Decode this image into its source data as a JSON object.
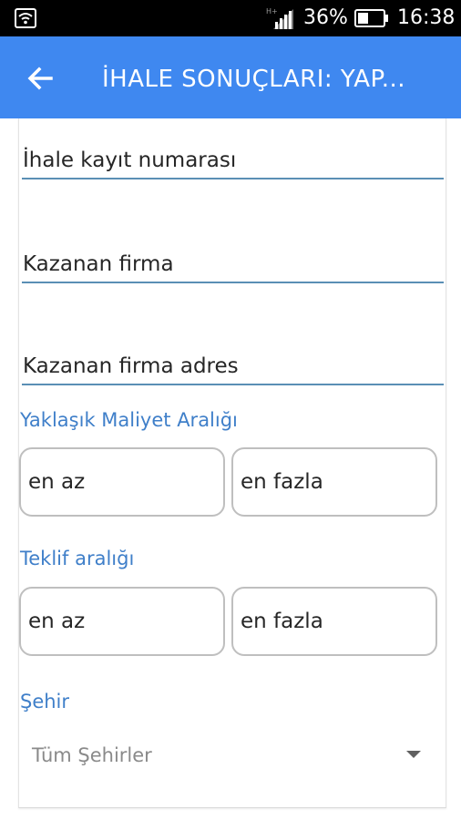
{
  "status_bar": {
    "battery_percent": "36%",
    "time": "16:38",
    "icons": [
      "notification-icon",
      "signal-icon",
      "battery-icon"
    ]
  },
  "app_bar": {
    "title": "İHALE SONUÇLARI: YAP...",
    "back_icon": "arrow-left-icon",
    "color": "#3f88f0"
  },
  "form": {
    "record_number_placeholder": "İhale kayıt numarası",
    "winning_company_placeholder": "Kazanan firma",
    "winning_company_address_placeholder": "Kazanan firma adres",
    "estimated_cost": {
      "label": "Yaklaşık Maliyet Aralığı",
      "min_placeholder": "en az",
      "max_placeholder": "en fazla"
    },
    "bid_range": {
      "label": "Teklif aralığı",
      "min_placeholder": "en az",
      "max_placeholder": "en fazla"
    },
    "city": {
      "label": "Şehir",
      "selected": "Tüm Şehirler"
    }
  },
  "colors": {
    "accent_label": "#3f7fc9",
    "underline": "#5a8fb5"
  }
}
